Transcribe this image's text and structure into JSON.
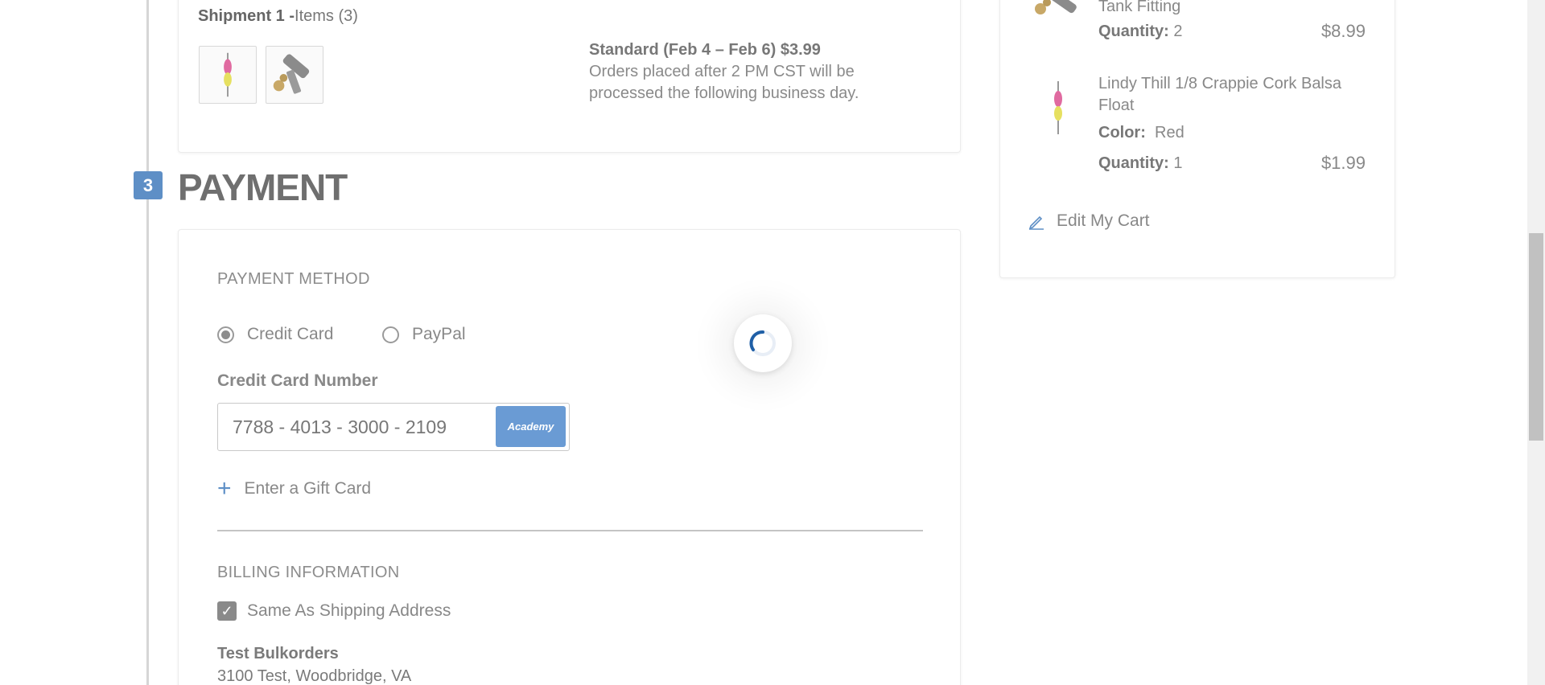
{
  "shipment": {
    "title": "Shipment 1 -",
    "items_label": "Items (3)",
    "method": "Standard (Feb 4 – Feb 6) $3.99",
    "note": "Orders placed after 2 PM CST will be processed the following business day."
  },
  "step": {
    "number": "3",
    "title": "PAYMENT"
  },
  "payment": {
    "method_label": "PAYMENT METHOD",
    "options": [
      {
        "label": "Credit Card",
        "selected": true
      },
      {
        "label": "PayPal",
        "selected": false
      }
    ],
    "card_number_label": "Credit Card Number",
    "card_number_value": "7788 - 4013 - 3000 - 2109",
    "card_brand": "Academy",
    "gift_card_label": "Enter a Gift Card",
    "billing_label": "BILLING INFORMATION",
    "same_as_shipping_label": "Same As Shipping Address",
    "same_as_shipping_checked": true,
    "billing_name": "Test Bulkorders",
    "billing_address": "3100 Test, Woodbridge, VA"
  },
  "summary": {
    "items": [
      {
        "name": "Tank Fitting",
        "quantity_label": "Quantity:",
        "quantity": "2",
        "price": "$8.99"
      },
      {
        "name": "Lindy Thill 1/8 Crappie Cork Balsa Float",
        "color_label": "Color:",
        "color": "Red",
        "quantity_label": "Quantity:",
        "quantity": "1",
        "price": "$1.99"
      }
    ],
    "edit_cart_label": "Edit My Cart"
  },
  "colors": {
    "accent": "#5e8fc6",
    "spinner": "#1f5fa6"
  }
}
